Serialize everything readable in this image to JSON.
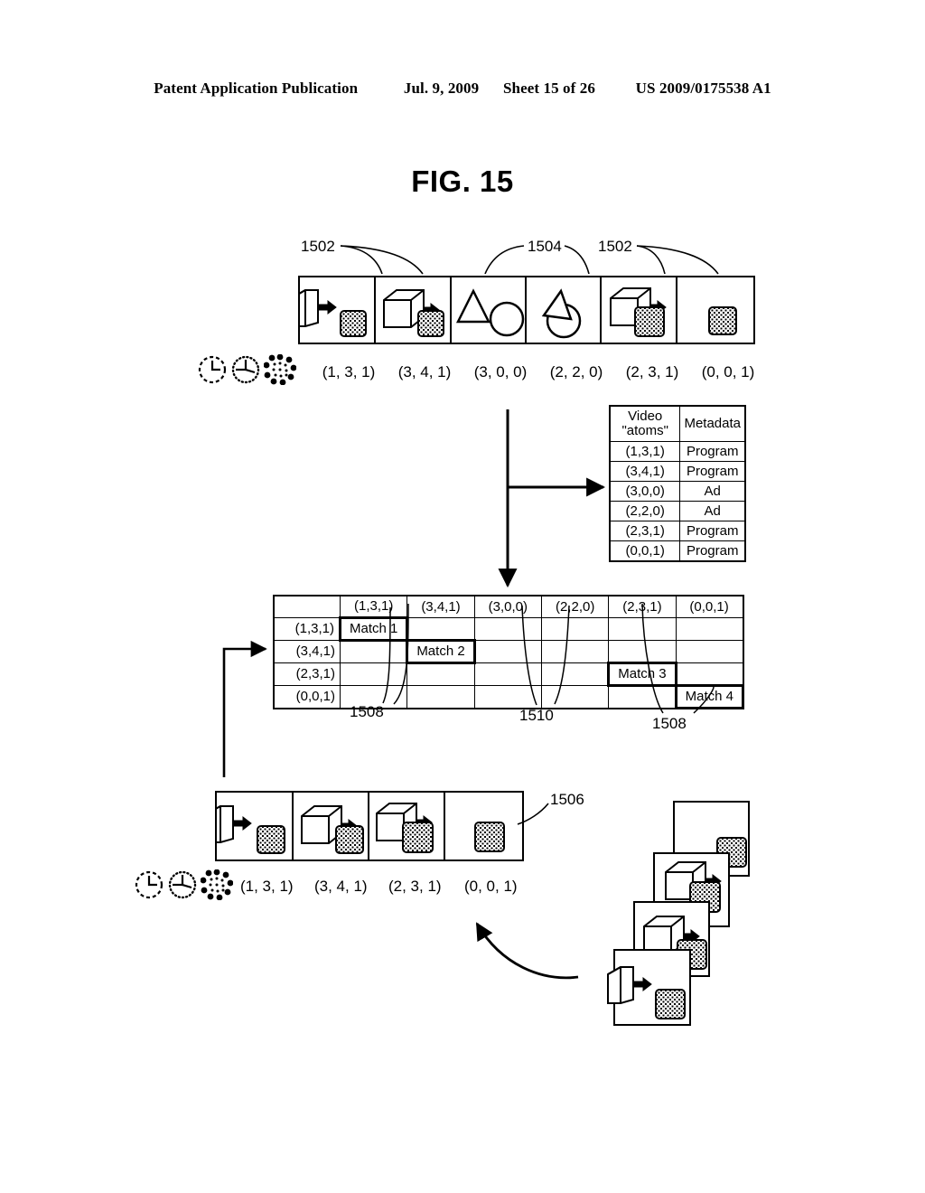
{
  "header": {
    "publication": "Patent Application Publication",
    "date": "Jul. 9, 2009",
    "sheet": "Sheet 15 of 26",
    "docnum": "US 2009/0175538 A1"
  },
  "figure": {
    "title": "FIG. 15"
  },
  "refs": {
    "r1502_a": "1502",
    "r1504": "1504",
    "r1502_b": "1502",
    "r1508_a": "1508",
    "r1510": "1510",
    "r1508_b": "1508",
    "r1506": "1506"
  },
  "top_strip": {
    "labels": [
      "(1, 3, 1)",
      "(3, 4, 1)",
      "(3, 0, 0)",
      "(2, 2, 0)",
      "(2, 3, 1)",
      "(0, 0, 1)"
    ],
    "frames": [
      {
        "kind": "half-cube-dot"
      },
      {
        "kind": "cube-dot"
      },
      {
        "kind": "triangle-circle"
      },
      {
        "kind": "triangle-circle-overlap"
      },
      {
        "kind": "cube-dot-overlap"
      },
      {
        "kind": "dot-only"
      }
    ]
  },
  "bottom_strip": {
    "labels": [
      "(1, 3, 1)",
      "(3, 4, 1)",
      "(2, 3, 1)",
      "(0, 0, 1)"
    ],
    "frames": [
      {
        "kind": "half-cube-dot"
      },
      {
        "kind": "cube-dot"
      },
      {
        "kind": "cube-dot-overlap"
      },
      {
        "kind": "dot-only"
      }
    ]
  },
  "icons": {
    "dashed_clock": "dashed-clock-icon",
    "dotted_clock": "dotted-clock-icon",
    "atom_cluster": "atom-cluster-icon"
  },
  "metadata_table": {
    "headers": [
      "Video \"atoms\"",
      "Metadata"
    ],
    "header_line1": "Video",
    "header_line2": "\"atoms\"",
    "rows": [
      [
        "(1,3,1)",
        "Program"
      ],
      [
        "(3,4,1)",
        "Program"
      ],
      [
        "(3,0,0)",
        "Ad"
      ],
      [
        "(2,2,0)",
        "Ad"
      ],
      [
        "(2,3,1)",
        "Program"
      ],
      [
        "(0,0,1)",
        "Program"
      ]
    ]
  },
  "match_matrix": {
    "corner": "",
    "columns": [
      "(1,3,1)",
      "(3,4,1)",
      "(3,0,0)",
      "(2,2,0)",
      "(2,3,1)",
      "(0,0,1)"
    ],
    "rows": [
      {
        "header": "(1,3,1)",
        "cells": [
          "Match 1",
          "",
          "",
          "",
          "",
          ""
        ]
      },
      {
        "header": "(3,4,1)",
        "cells": [
          "",
          "Match 2",
          "",
          "",
          "",
          ""
        ]
      },
      {
        "header": "(2,3,1)",
        "cells": [
          "",
          "",
          "",
          "",
          "Match 3",
          ""
        ]
      },
      {
        "header": "(0,0,1)",
        "cells": [
          "",
          "",
          "",
          "",
          "",
          "Match 4"
        ]
      }
    ]
  },
  "stack": {
    "frames": [
      {
        "kind": "dot-only"
      },
      {
        "kind": "cube-dot-overlap"
      },
      {
        "kind": "cube-dot"
      },
      {
        "kind": "half-cube-dot"
      }
    ]
  },
  "colors": {
    "ink": "#000000",
    "paper": "#ffffff"
  }
}
